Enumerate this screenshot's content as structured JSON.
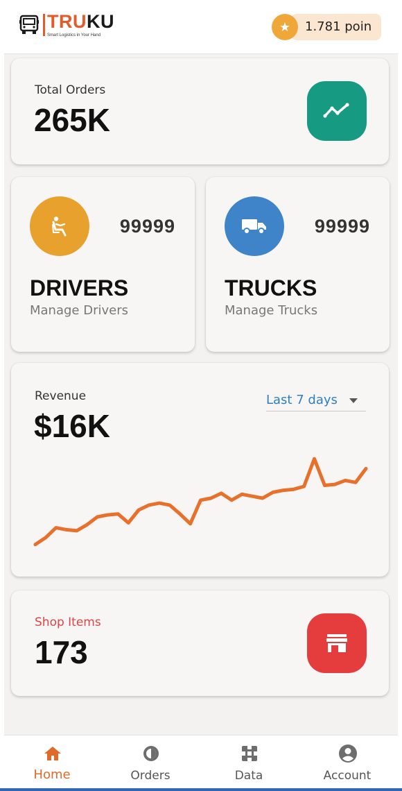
{
  "header": {
    "logo_primary": "TRU",
    "logo_secondary": "KU",
    "logo_tagline": "Smart Logistics in Your Hand",
    "points_label": "1.781 poin",
    "points_icon": "star-icon"
  },
  "total_orders": {
    "label": "Total Orders",
    "value": "265K",
    "icon": "trend-line-icon",
    "icon_color": "#169a82"
  },
  "drivers": {
    "count": "99999",
    "title": "DRIVERS",
    "subtitle": "Manage Drivers",
    "icon": "seated-driver-icon",
    "icon_color": "#e8a12d"
  },
  "trucks": {
    "count": "99999",
    "title": "TRUCKS",
    "subtitle": "Manage Trucks",
    "icon": "truck-icon",
    "icon_color": "#3f84c8"
  },
  "revenue": {
    "label": "Revenue",
    "value": "$16K",
    "range_selected": "Last 7 days",
    "line_color": "#e8702a"
  },
  "chart_data": {
    "type": "line",
    "title": "",
    "xlabel": "",
    "ylabel": "",
    "grid": false,
    "legend": "none",
    "ylim": [
      0,
      100
    ],
    "x": [
      1,
      2,
      3,
      4,
      5,
      6,
      7,
      8,
      9,
      10,
      11,
      12,
      13,
      14,
      15,
      16,
      17,
      18,
      19,
      20,
      21,
      22,
      23,
      24,
      25,
      26,
      27,
      28,
      29,
      30,
      31,
      32,
      33
    ],
    "values": [
      3,
      10,
      20,
      18,
      17,
      23,
      31,
      33,
      34,
      25,
      38,
      43,
      45,
      43,
      34,
      24,
      48,
      50,
      55,
      48,
      54,
      52,
      50,
      56,
      58,
      59,
      62,
      90,
      63,
      64,
      68,
      66,
      80
    ]
  },
  "shop": {
    "label": "Shop Items",
    "value": "173",
    "icon": "store-icon",
    "icon_color": "#e53d3d",
    "label_color": "#e04343"
  },
  "nav": {
    "items": [
      {
        "label": "Home",
        "icon": "home-icon",
        "active": true
      },
      {
        "label": "Orders",
        "icon": "orders-icon",
        "active": false
      },
      {
        "label": "Data",
        "icon": "data-icon",
        "active": false
      },
      {
        "label": "Account",
        "icon": "account-icon",
        "active": false
      }
    ],
    "active_color": "#e06a2a"
  }
}
